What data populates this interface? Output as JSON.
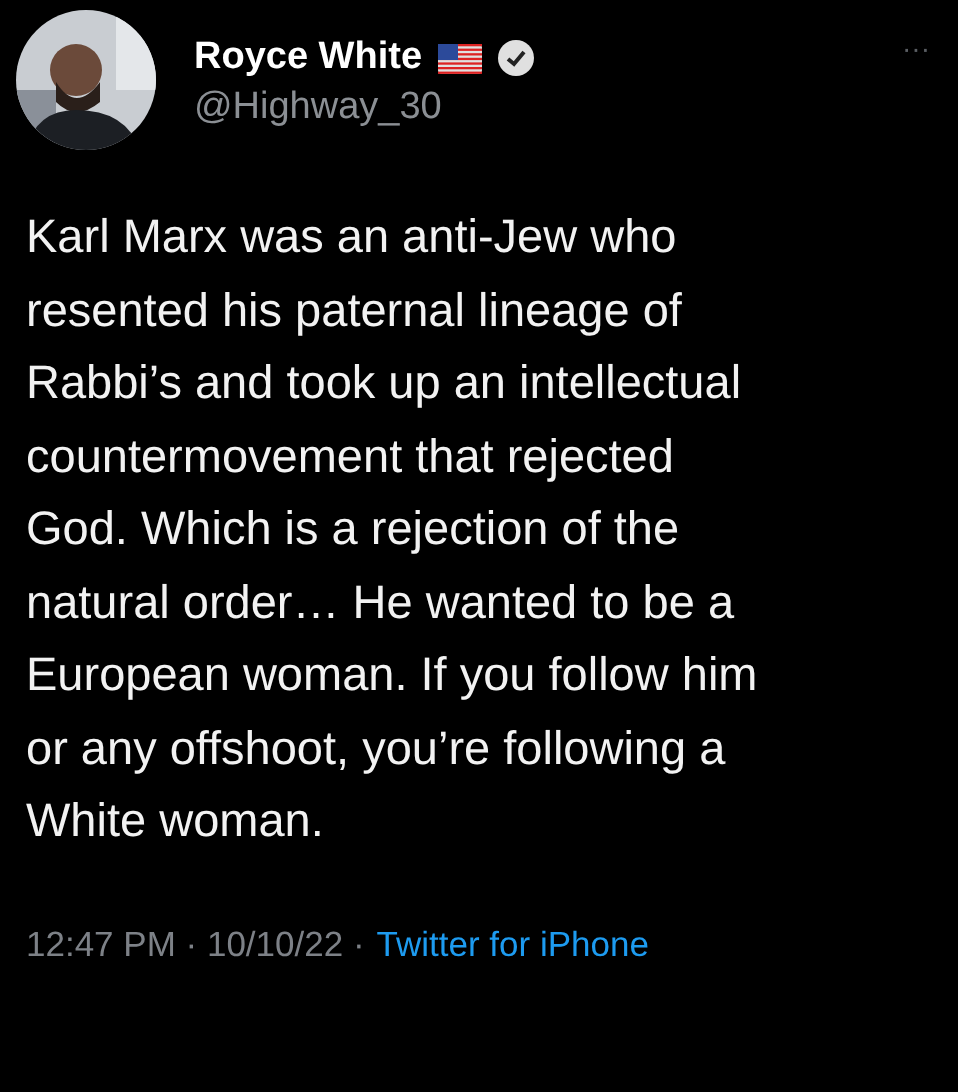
{
  "author": {
    "name": "Royce White",
    "handle": "@Highway_30",
    "verified": true
  },
  "more": "···",
  "tweet_lines": [
    "Karl Marx was an anti-Jew who",
    "resented his paternal lineage of",
    "Rabbi’s and took up an intellectual",
    "countermovement that rejected",
    "God. Which is a rejection of the",
    "natural order… He wanted to be a",
    "European woman. If you follow him",
    "or any offshoot, you’re following a",
    "White woman."
  ],
  "meta": {
    "time": "12:47 PM · 10/10/22 ·",
    "source": "Twitter for iPhone"
  }
}
